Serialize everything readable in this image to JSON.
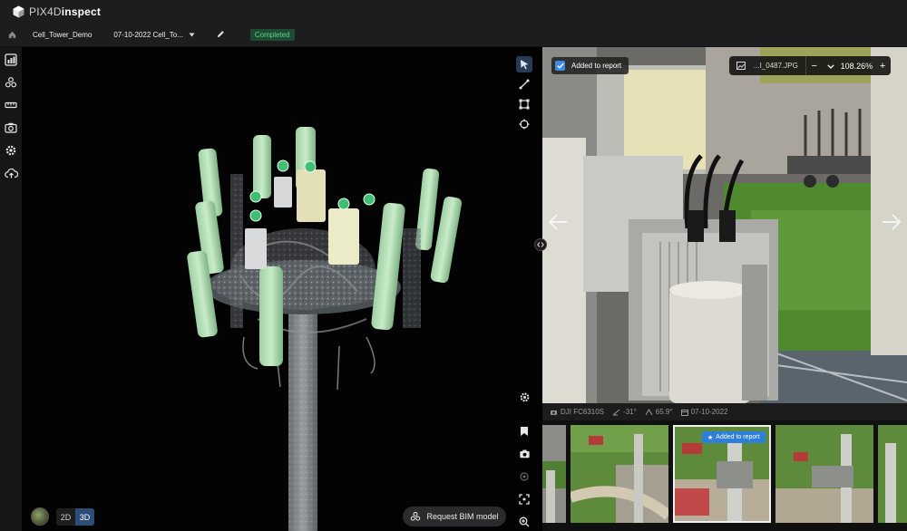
{
  "app": {
    "brand_prefix": "PIX4D",
    "brand_suffix": "inspect"
  },
  "breadcrumb": {
    "project": "Cell_Tower_Demo",
    "dataset": "07-10-2022 Cell_To...",
    "status": "Completed"
  },
  "viewer": {
    "mode_2d": "2D",
    "mode_3d": "3D",
    "active_mode": "3D",
    "bim_button": "Request BIM model"
  },
  "photo": {
    "report_label": "Added to report",
    "filename": "...I_0487.JPG",
    "zoom": "108.26%",
    "zoom_out": "−",
    "zoom_in": "+"
  },
  "metadata": {
    "camera": "DJI FC6310S",
    "pitch": "-31°",
    "angle": "65.9°",
    "date": "07-10-2022"
  },
  "filmstrip": {
    "selected_chip": "Added to report"
  },
  "colors": {
    "accent": "#3f88e8",
    "status_green": "#58d68d",
    "toggle_active": "#2c4d78"
  }
}
